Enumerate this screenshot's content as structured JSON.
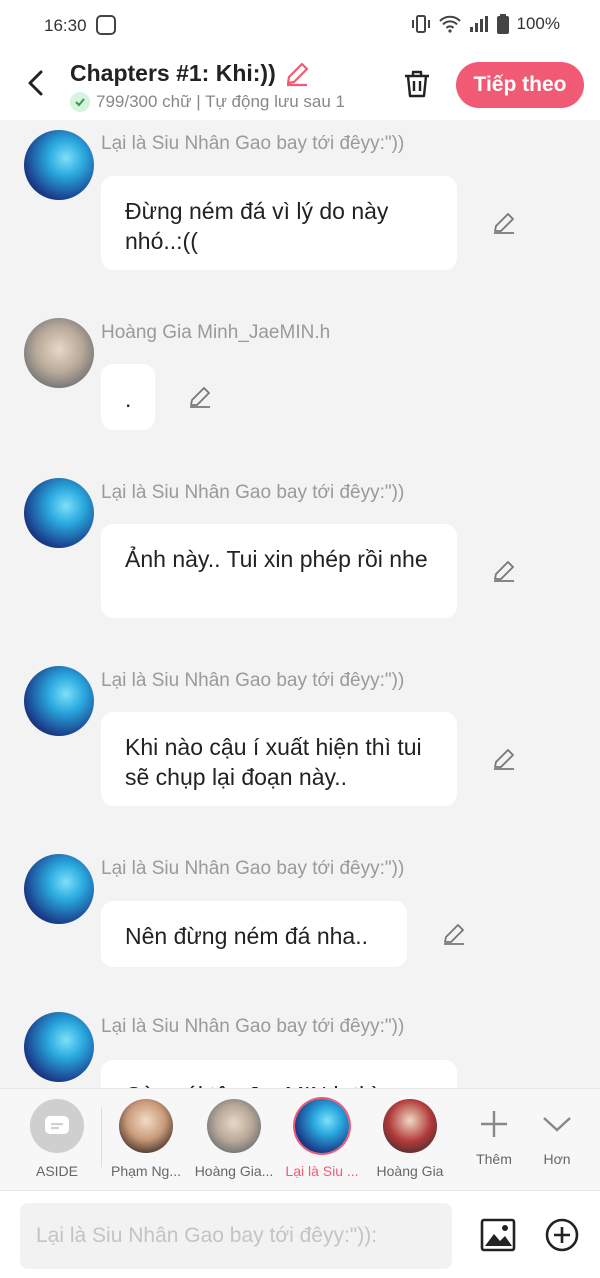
{
  "status": {
    "time": "16:30",
    "battery": "100%"
  },
  "header": {
    "title": "Chapters #1: Khi:))",
    "subtitle": "799/300 chữ | Tự động lưu sau 1",
    "next_label": "Tiếp theo"
  },
  "messages": [
    {
      "sender": "Lại là Siu Nhân Gao bay tới đêyy:\"))",
      "text": "Đừng ném đá vì lý do này nhó..:((",
      "avatar": "siu"
    },
    {
      "sender": "Hoàng Gia Minh_JaeMIN.h",
      "text": ".",
      "avatar": "minh"
    },
    {
      "sender": "Lại là Siu Nhân Gao bay tới đêyy:\"))",
      "text": "Ảnh này.. Tui xin phép rồi nhe",
      "avatar": "siu"
    },
    {
      "sender": "Lại là Siu Nhân Gao bay tới đêyy:\"))",
      "text": "Khi nào cậu í xuất hiện thì tui sẽ chụp lại đoạn này..",
      "avatar": "siu"
    },
    {
      "sender": "Lại là Siu Nhân Gao bay tới đêyy:\"))",
      "text": "Nên đừng ném đá nha..",
      "avatar": "siu"
    },
    {
      "sender": "Lại là Siu Nhân Gao bay tới đêyy:\"))",
      "text": "Còn cái tên JaeMIN.h thì",
      "avatar": "siu"
    }
  ],
  "characters": [
    {
      "name": "ASIDE",
      "active": false
    },
    {
      "name": "Phạm Ng...",
      "active": false
    },
    {
      "name": "Hoàng Gia...",
      "active": false
    },
    {
      "name": "Lại là Siu ...",
      "active": true
    },
    {
      "name": "Hoàng Gia",
      "active": false
    }
  ],
  "tools": {
    "add_label": "Thêm",
    "more_label": "Hơn"
  },
  "input": {
    "placeholder": "Lại là Siu Nhân Gao bay tới đêyy:\")):"
  }
}
